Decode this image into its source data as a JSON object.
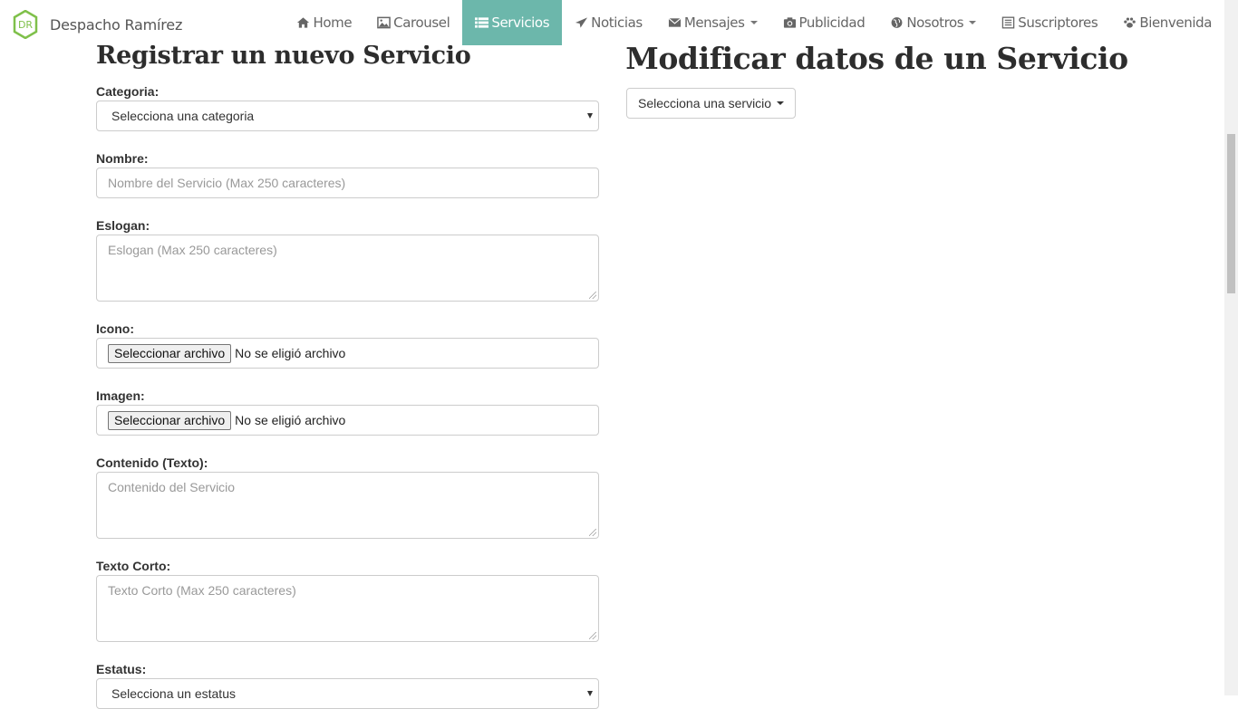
{
  "brand": {
    "name": "Despacho Ramírez",
    "logo_text": "DR"
  },
  "nav": {
    "items": [
      {
        "label": "Home",
        "icon": "home-icon"
      },
      {
        "label": "Carousel",
        "icon": "picture-icon"
      },
      {
        "label": "Servicios",
        "icon": "list-icon",
        "active": true
      },
      {
        "label": "Noticias",
        "icon": "send-icon"
      },
      {
        "label": "Mensajes",
        "icon": "envelope-icon",
        "dropdown": true
      },
      {
        "label": "Publicidad",
        "icon": "camera-icon"
      },
      {
        "label": "Nosotros",
        "icon": "globe-icon",
        "dropdown": true
      },
      {
        "label": "Suscriptores",
        "icon": "list-alt-icon"
      },
      {
        "label": "Bienvenida",
        "icon": "paw-icon"
      }
    ],
    "active_color": "#6cb7ab"
  },
  "form": {
    "title": "Registrar un nuevo Servicio",
    "categoria_label": "Categoria:",
    "categoria_value": "Selecciona una categoria",
    "nombre_label": "Nombre:",
    "nombre_placeholder": "Nombre del Servicio (Max 250 caracteres)",
    "eslogan_label": "Eslogan:",
    "eslogan_placeholder": "Eslogan (Max 250 caracteres)",
    "icono_label": "Icono:",
    "imagen_label": "Imagen:",
    "file_button": "Seleccionar archivo",
    "file_none": "No se eligió archivo",
    "contenido_label": "Contenido (Texto):",
    "contenido_placeholder": "Contenido del Servicio",
    "texto_corto_label": "Texto Corto:",
    "texto_corto_placeholder": "Texto Corto (Max 250 caracteres)",
    "estatus_label": "Estatus:",
    "estatus_value": "Selecciona un estatus"
  },
  "modify": {
    "title": "Modificar datos de un Servicio",
    "dropdown_label": "Selecciona una servicio"
  }
}
